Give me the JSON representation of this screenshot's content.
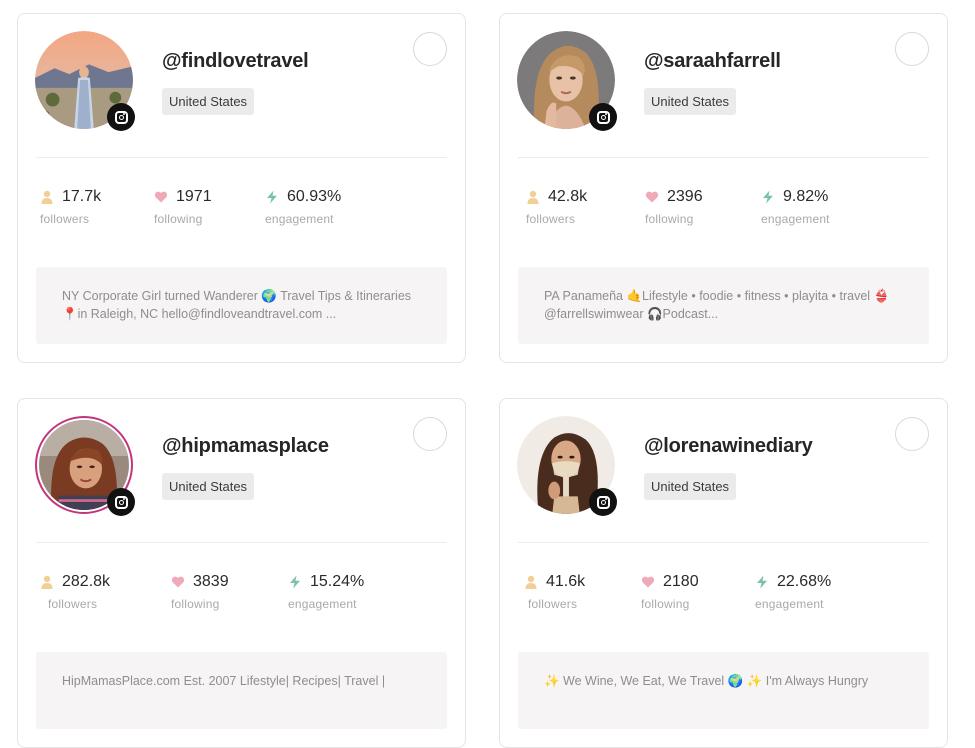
{
  "cards": [
    {
      "handle": "@findlovetravel",
      "country": "United States",
      "followers": "17.7k",
      "following": "1971",
      "engagement": "60.93%",
      "followers_label": "followers",
      "following_label": "following",
      "engagement_label": "engagement",
      "bio": "NY Corporate Girl turned Wanderer 🌍 Travel Tips & Itineraries📍in Raleigh, NC hello@findloveandtravel.com ..."
    },
    {
      "handle": "@saraahfarrell",
      "country": "United States",
      "followers": "42.8k",
      "following": "2396",
      "engagement": "9.82%",
      "followers_label": "followers",
      "following_label": "following",
      "engagement_label": "engagement",
      "bio": "PA Panameña 🤙Lifestyle • foodie • fitness • playita • travel 👙 @farrellswimwear 🎧Podcast..."
    },
    {
      "handle": "@hipmamasplace",
      "country": "United States",
      "followers": "282.8k",
      "following": "3839",
      "engagement": "15.24%",
      "followers_label": "followers",
      "following_label": "following",
      "engagement_label": "engagement",
      "bio": "HipMamasPlace.com Est. 2007 Lifestyle| Recipes| Travel |"
    },
    {
      "handle": "@lorenawinediary",
      "country": "United States",
      "followers": "41.6k",
      "following": "2180",
      "engagement": "22.68%",
      "followers_label": "followers",
      "following_label": "following",
      "engagement_label": "engagement",
      "bio": "✨ We Wine, We Eat, We Travel 🌍 ✨ I'm Always Hungry"
    }
  ],
  "icons": {
    "followers": "person-icon",
    "following": "heart-icon",
    "engagement": "lightning-icon",
    "platform": "instagram-icon"
  },
  "colors": {
    "followers_icon": "#f2cf96",
    "following_icon": "#f0a9b9",
    "engagement_icon": "#7cc3a5",
    "instagram_badge": "#111111",
    "story_ring": "#c2357e"
  }
}
